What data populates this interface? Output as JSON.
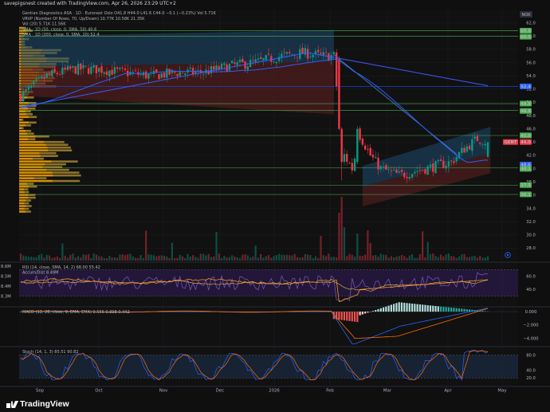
{
  "header": {
    "created_by": "savepigsnest created with TradingView.com, Apr 26, 2026 23:29 UTC+2"
  },
  "brand": {
    "name": "TradingView"
  },
  "chart_data": {
    "type": "candlestick",
    "symbol_line": "Gentian Diagnostics ASA · 1D · Euronext Oslo",
    "ohlc_text": "O41.8 H44.0 L41.6 C44.0 −0.1 (−0.23%)",
    "vol_text": "Vol 5.71K",
    "currency": "NOK",
    "indicators": [
      {
        "label": "VRVP (Number Of Rows, 70, Up/Down)",
        "values": "10.77K  10.58K  21.35K"
      },
      {
        "label": "Vol (20)",
        "values": "5.71K  11.56K"
      },
      {
        "label": "SMA · 1D (50, close, 0, SMA, 50)",
        "values": "40.6"
      },
      {
        "label": "SMA · 1D (200, close, 0, SMA, 20)",
        "values": "52.4"
      }
    ],
    "price_axis": {
      "ylim": [
        26,
        64
      ],
      "ticks": [
        28.0,
        30.0,
        32.0,
        34.0,
        36.0,
        38.0,
        40.0,
        42.0,
        44.0,
        46.0,
        48.0,
        50.0,
        52.0,
        54.0,
        56.0,
        58.0,
        60.0,
        62.0
      ]
    },
    "x_labels": [
      "Sep",
      "Oct",
      "Nov",
      "Dec",
      "2026",
      "Feb",
      "Mar",
      "Apr",
      "May"
    ],
    "price_tags": [
      {
        "label": "60.8",
        "value": 60.8,
        "color": "#4caf50"
      },
      {
        "label": "60.0",
        "value": 60.0,
        "color": "#4caf50"
      },
      {
        "label": "52.4",
        "value": 52.4,
        "color": "#2962ff"
      },
      {
        "label": "49.8",
        "value": 49.8,
        "color": "#4caf50"
      },
      {
        "label": "48.8",
        "value": 48.8,
        "color": "#4caf50"
      },
      {
        "label": "45.0",
        "value": 45.0,
        "color": "#4caf50"
      },
      {
        "label": "GENT",
        "value": 44.0,
        "color": "#f23645"
      },
      {
        "label": "44.0",
        "value": 44.0,
        "color": "#f23645"
      },
      {
        "label": "40.6",
        "value": 40.6,
        "color": "#2962ff"
      },
      {
        "label": "40.1",
        "value": 40.1,
        "color": "#4caf50"
      },
      {
        "label": "37.5",
        "value": 37.5,
        "color": "#4caf50"
      },
      {
        "label": "36.1",
        "value": 36.1,
        "color": "#4caf50"
      }
    ],
    "rsi": {
      "label": "RSI (14, close, SMA, 14, 2)",
      "values_text": "68.00  55.42",
      "accum_label": "Accum/Dist",
      "accum_value": "8.49M",
      "left_ticks": [
        "8.6M",
        "8.5M",
        "8.4M",
        "8.3M"
      ],
      "ticks": [
        60.0,
        40.0
      ],
      "ylim": [
        15,
        80
      ]
    },
    "macd": {
      "label": "MACD (12, 26, close, 9, EMA, EMA)",
      "values_text": "0.556  0.998  0.442",
      "ticks": [
        0.0,
        -2.0,
        -4.0
      ],
      "ylim": [
        -5.1,
        0.6
      ]
    },
    "stoch": {
      "label": "Stoch (14, 1, 3)",
      "values_text": "85.51  90.82",
      "ticks": [
        80.0,
        40.0,
        20.0
      ],
      "ylim": [
        0,
        100
      ]
    },
    "colors": {
      "up": "#089981",
      "down": "#f23645",
      "sma_fast": "#2962ff",
      "sma_slow": "#2962ff",
      "profile_up": "#f7a600",
      "profile_down": "#f5c542",
      "channel_upper": "#1e4a6e",
      "channel_lower": "#5c1f21",
      "sr_line": "#4caf50"
    }
  }
}
